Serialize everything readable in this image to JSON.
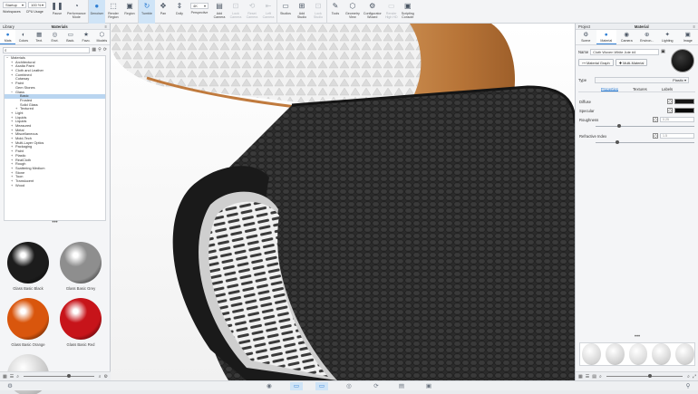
{
  "toolbar": {
    "startup": "Startup",
    "zoom": "100 %",
    "workspaces": "Workspaces",
    "cpu_usage": "CPU Usage",
    "pause": "Pause",
    "performance_mode": "Performance\nMode",
    "denoiser": "Denoiser",
    "render_region": "Render\nRegion",
    "region": "Region",
    "resolution": "4K",
    "tumble": "Tumble",
    "pan": "Pan",
    "dolly": "Dolly",
    "perspective": "Perspective",
    "add_camera": "Add\nCamera",
    "lock_camera": "Lock\nCamera",
    "reset_camera": "Reset\nCamera",
    "left_camera": "Left\nCamera",
    "studios": "Studios",
    "add_studio": "Add\nStudio",
    "lock_studio": "Lock\nStudio",
    "tools": "Tools",
    "geometry_view": "Geometry\nView",
    "configurator_wizard": "Configurator\nWizard",
    "render_hd": "Render\nHigh HD",
    "scripting_console": "Scripting\nConsole"
  },
  "library": {
    "title": "Library",
    "panel_title": "Materials",
    "tabs": [
      "Mats",
      "Colors",
      "Text.",
      "Envi.",
      "Back.",
      "Favo.",
      "Models"
    ],
    "search_placeholder": "",
    "tree": [
      {
        "label": "Materials",
        "level": 0,
        "toggle": "−"
      },
      {
        "label": "Architectural",
        "level": 1,
        "toggle": "+"
      },
      {
        "label": "Axalta Paint",
        "level": 1,
        "toggle": "+"
      },
      {
        "label": "Cloth and Leather",
        "level": 1,
        "toggle": "+"
      },
      {
        "label": "Combined",
        "level": 1,
        "toggle": "+"
      },
      {
        "label": "Cutaway",
        "level": 1,
        "toggle": ""
      },
      {
        "label": "Paint",
        "level": 1,
        "toggle": "+"
      },
      {
        "label": "Gem Stones",
        "level": 1,
        "toggle": ""
      },
      {
        "label": "Glass",
        "level": 1,
        "toggle": "−"
      },
      {
        "label": "Basic",
        "level": 2,
        "toggle": "",
        "selected": true
      },
      {
        "label": "Frosted",
        "level": 2,
        "toggle": ""
      },
      {
        "label": "Solid Glass",
        "level": 2,
        "toggle": ""
      },
      {
        "label": "Textured",
        "level": 2,
        "toggle": "+"
      },
      {
        "label": "Light",
        "level": 1,
        "toggle": "+"
      },
      {
        "label": "Liquids",
        "level": 1,
        "toggle": "+"
      },
      {
        "label": "Liquids",
        "level": 1,
        "toggle": "+"
      },
      {
        "label": "Measured",
        "level": 1,
        "toggle": "+"
      },
      {
        "label": "Metal",
        "level": 1,
        "toggle": "+"
      },
      {
        "label": "Miscellaneous",
        "level": 1,
        "toggle": "+"
      },
      {
        "label": "Mold-Tech",
        "level": 1,
        "toggle": "+"
      },
      {
        "label": "Multi-Layer Optics",
        "level": 1,
        "toggle": "+"
      },
      {
        "label": "Packaging",
        "level": 1,
        "toggle": "+"
      },
      {
        "label": "Paint",
        "level": 1,
        "toggle": "+"
      },
      {
        "label": "Plastic",
        "level": 1,
        "toggle": "+"
      },
      {
        "label": "RealCloth",
        "level": 1,
        "toggle": "+"
      },
      {
        "label": "Rough",
        "level": 1,
        "toggle": "+"
      },
      {
        "label": "Scattering Medium",
        "level": 1,
        "toggle": "+"
      },
      {
        "label": "Stone",
        "level": 1,
        "toggle": "+"
      },
      {
        "label": "Toon",
        "level": 1,
        "toggle": "+"
      },
      {
        "label": "Translucent",
        "level": 1,
        "toggle": "+"
      },
      {
        "label": "Wood",
        "level": 1,
        "toggle": "+"
      }
    ],
    "swatches": [
      {
        "name": "Glass Basic Black",
        "color": "#1c1c1c"
      },
      {
        "name": "Glass Basic Grey",
        "color": "#8e8e8e"
      },
      {
        "name": "Glass Basic Orange",
        "color": "#d9560d"
      },
      {
        "name": "Glass Basic Red",
        "color": "#c7141a"
      }
    ]
  },
  "project": {
    "title": "Project",
    "panel_title": "Material",
    "tabs": [
      "Scene",
      "Material",
      "Camera",
      "Environ...",
      "Lighting",
      "Image"
    ],
    "name_label": "Name",
    "name_value": "Cloth Woven White Jute #4",
    "material_graph": "Material Graph",
    "multi_material": "Multi-Material",
    "type_label": "Type",
    "type_value": "Plastic",
    "subtabs": [
      "Properties",
      "Textures",
      "Labels"
    ],
    "active_subtab": "Properties",
    "props": {
      "diffuse": "Diffuse",
      "specular": "Specular",
      "roughness": "Roughness",
      "roughness_value": "0.25",
      "refractive_index": "Refractive Index",
      "refractive_value": "1.5"
    },
    "roughness_level": 0.22,
    "ior_level": 0.2,
    "thumb_dots": "•••"
  },
  "colors": {
    "accent": "#2f7fd4",
    "diffuse": "#161616",
    "specular": "#080808"
  }
}
